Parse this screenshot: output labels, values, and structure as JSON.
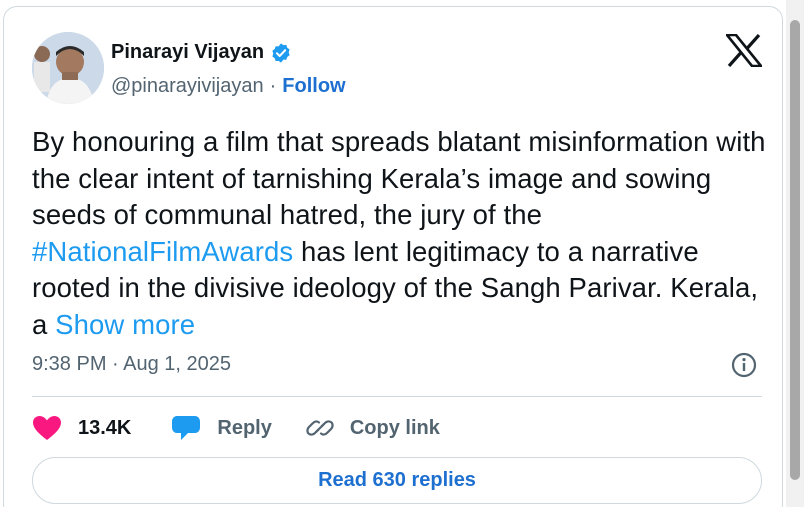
{
  "author": {
    "name": "Pinarayi Vijayan",
    "handle": "@pinarayivijayan",
    "separator": "·",
    "follow_label": "Follow"
  },
  "tweet": {
    "text_before": "By honouring a film that spreads blatant misinformation with the clear intent of tarnishing Kerala’s image and sowing seeds of communal hatred, the jury of the ",
    "hashtag": "#NationalFilmAwards",
    "text_after": " has lent legitimacy to a narrative rooted in the divisive ideology of the Sangh Parivar. Kerala, a ",
    "show_more_label": "Show more",
    "timestamp": "9:38 PM · Aug 1, 2025"
  },
  "actions": {
    "like_count": "13.4K",
    "reply_label": "Reply",
    "copy_link_label": "Copy link"
  },
  "read_replies_label": "Read 630 replies",
  "icons": {
    "verified": "verified-badge-icon",
    "x_logo": "x-logo-icon",
    "info": "info-icon",
    "like": "heart-icon",
    "reply": "reply-bubble-icon",
    "copy": "link-icon"
  },
  "colors": {
    "link": "#1d9bf0",
    "follow": "#1d6fd0",
    "heart": "#f91880",
    "secondary_text": "#536471",
    "border": "#cfd9de"
  }
}
